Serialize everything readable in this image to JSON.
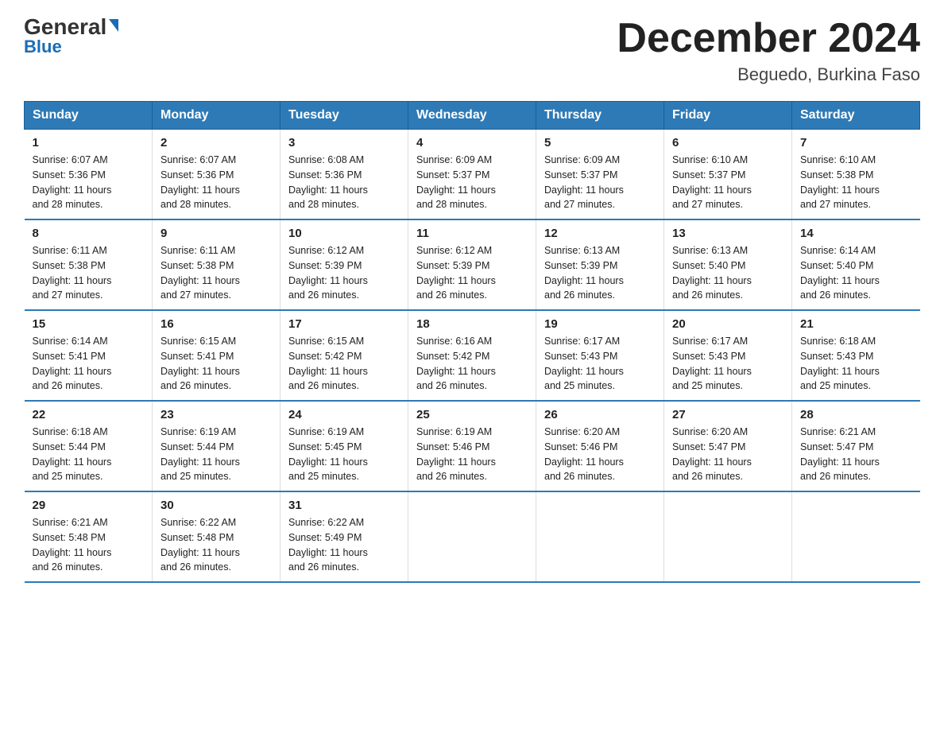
{
  "logo": {
    "general": "General",
    "blue": "Blue"
  },
  "header": {
    "month": "December 2024",
    "location": "Beguedo, Burkina Faso"
  },
  "weekdays": [
    "Sunday",
    "Monday",
    "Tuesday",
    "Wednesday",
    "Thursday",
    "Friday",
    "Saturday"
  ],
  "weeks": [
    [
      {
        "day": "1",
        "sunrise": "6:07 AM",
        "sunset": "5:36 PM",
        "daylight": "11 hours and 28 minutes."
      },
      {
        "day": "2",
        "sunrise": "6:07 AM",
        "sunset": "5:36 PM",
        "daylight": "11 hours and 28 minutes."
      },
      {
        "day": "3",
        "sunrise": "6:08 AM",
        "sunset": "5:36 PM",
        "daylight": "11 hours and 28 minutes."
      },
      {
        "day": "4",
        "sunrise": "6:09 AM",
        "sunset": "5:37 PM",
        "daylight": "11 hours and 28 minutes."
      },
      {
        "day": "5",
        "sunrise": "6:09 AM",
        "sunset": "5:37 PM",
        "daylight": "11 hours and 27 minutes."
      },
      {
        "day": "6",
        "sunrise": "6:10 AM",
        "sunset": "5:37 PM",
        "daylight": "11 hours and 27 minutes."
      },
      {
        "day": "7",
        "sunrise": "6:10 AM",
        "sunset": "5:38 PM",
        "daylight": "11 hours and 27 minutes."
      }
    ],
    [
      {
        "day": "8",
        "sunrise": "6:11 AM",
        "sunset": "5:38 PM",
        "daylight": "11 hours and 27 minutes."
      },
      {
        "day": "9",
        "sunrise": "6:11 AM",
        "sunset": "5:38 PM",
        "daylight": "11 hours and 27 minutes."
      },
      {
        "day": "10",
        "sunrise": "6:12 AM",
        "sunset": "5:39 PM",
        "daylight": "11 hours and 26 minutes."
      },
      {
        "day": "11",
        "sunrise": "6:12 AM",
        "sunset": "5:39 PM",
        "daylight": "11 hours and 26 minutes."
      },
      {
        "day": "12",
        "sunrise": "6:13 AM",
        "sunset": "5:39 PM",
        "daylight": "11 hours and 26 minutes."
      },
      {
        "day": "13",
        "sunrise": "6:13 AM",
        "sunset": "5:40 PM",
        "daylight": "11 hours and 26 minutes."
      },
      {
        "day": "14",
        "sunrise": "6:14 AM",
        "sunset": "5:40 PM",
        "daylight": "11 hours and 26 minutes."
      }
    ],
    [
      {
        "day": "15",
        "sunrise": "6:14 AM",
        "sunset": "5:41 PM",
        "daylight": "11 hours and 26 minutes."
      },
      {
        "day": "16",
        "sunrise": "6:15 AM",
        "sunset": "5:41 PM",
        "daylight": "11 hours and 26 minutes."
      },
      {
        "day": "17",
        "sunrise": "6:15 AM",
        "sunset": "5:42 PM",
        "daylight": "11 hours and 26 minutes."
      },
      {
        "day": "18",
        "sunrise": "6:16 AM",
        "sunset": "5:42 PM",
        "daylight": "11 hours and 26 minutes."
      },
      {
        "day": "19",
        "sunrise": "6:17 AM",
        "sunset": "5:43 PM",
        "daylight": "11 hours and 25 minutes."
      },
      {
        "day": "20",
        "sunrise": "6:17 AM",
        "sunset": "5:43 PM",
        "daylight": "11 hours and 25 minutes."
      },
      {
        "day": "21",
        "sunrise": "6:18 AM",
        "sunset": "5:43 PM",
        "daylight": "11 hours and 25 minutes."
      }
    ],
    [
      {
        "day": "22",
        "sunrise": "6:18 AM",
        "sunset": "5:44 PM",
        "daylight": "11 hours and 25 minutes."
      },
      {
        "day": "23",
        "sunrise": "6:19 AM",
        "sunset": "5:44 PM",
        "daylight": "11 hours and 25 minutes."
      },
      {
        "day": "24",
        "sunrise": "6:19 AM",
        "sunset": "5:45 PM",
        "daylight": "11 hours and 25 minutes."
      },
      {
        "day": "25",
        "sunrise": "6:19 AM",
        "sunset": "5:46 PM",
        "daylight": "11 hours and 26 minutes."
      },
      {
        "day": "26",
        "sunrise": "6:20 AM",
        "sunset": "5:46 PM",
        "daylight": "11 hours and 26 minutes."
      },
      {
        "day": "27",
        "sunrise": "6:20 AM",
        "sunset": "5:47 PM",
        "daylight": "11 hours and 26 minutes."
      },
      {
        "day": "28",
        "sunrise": "6:21 AM",
        "sunset": "5:47 PM",
        "daylight": "11 hours and 26 minutes."
      }
    ],
    [
      {
        "day": "29",
        "sunrise": "6:21 AM",
        "sunset": "5:48 PM",
        "daylight": "11 hours and 26 minutes."
      },
      {
        "day": "30",
        "sunrise": "6:22 AM",
        "sunset": "5:48 PM",
        "daylight": "11 hours and 26 minutes."
      },
      {
        "day": "31",
        "sunrise": "6:22 AM",
        "sunset": "5:49 PM",
        "daylight": "11 hours and 26 minutes."
      },
      null,
      null,
      null,
      null
    ]
  ],
  "labels": {
    "sunrise": "Sunrise:",
    "sunset": "Sunset:",
    "daylight": "Daylight:"
  }
}
